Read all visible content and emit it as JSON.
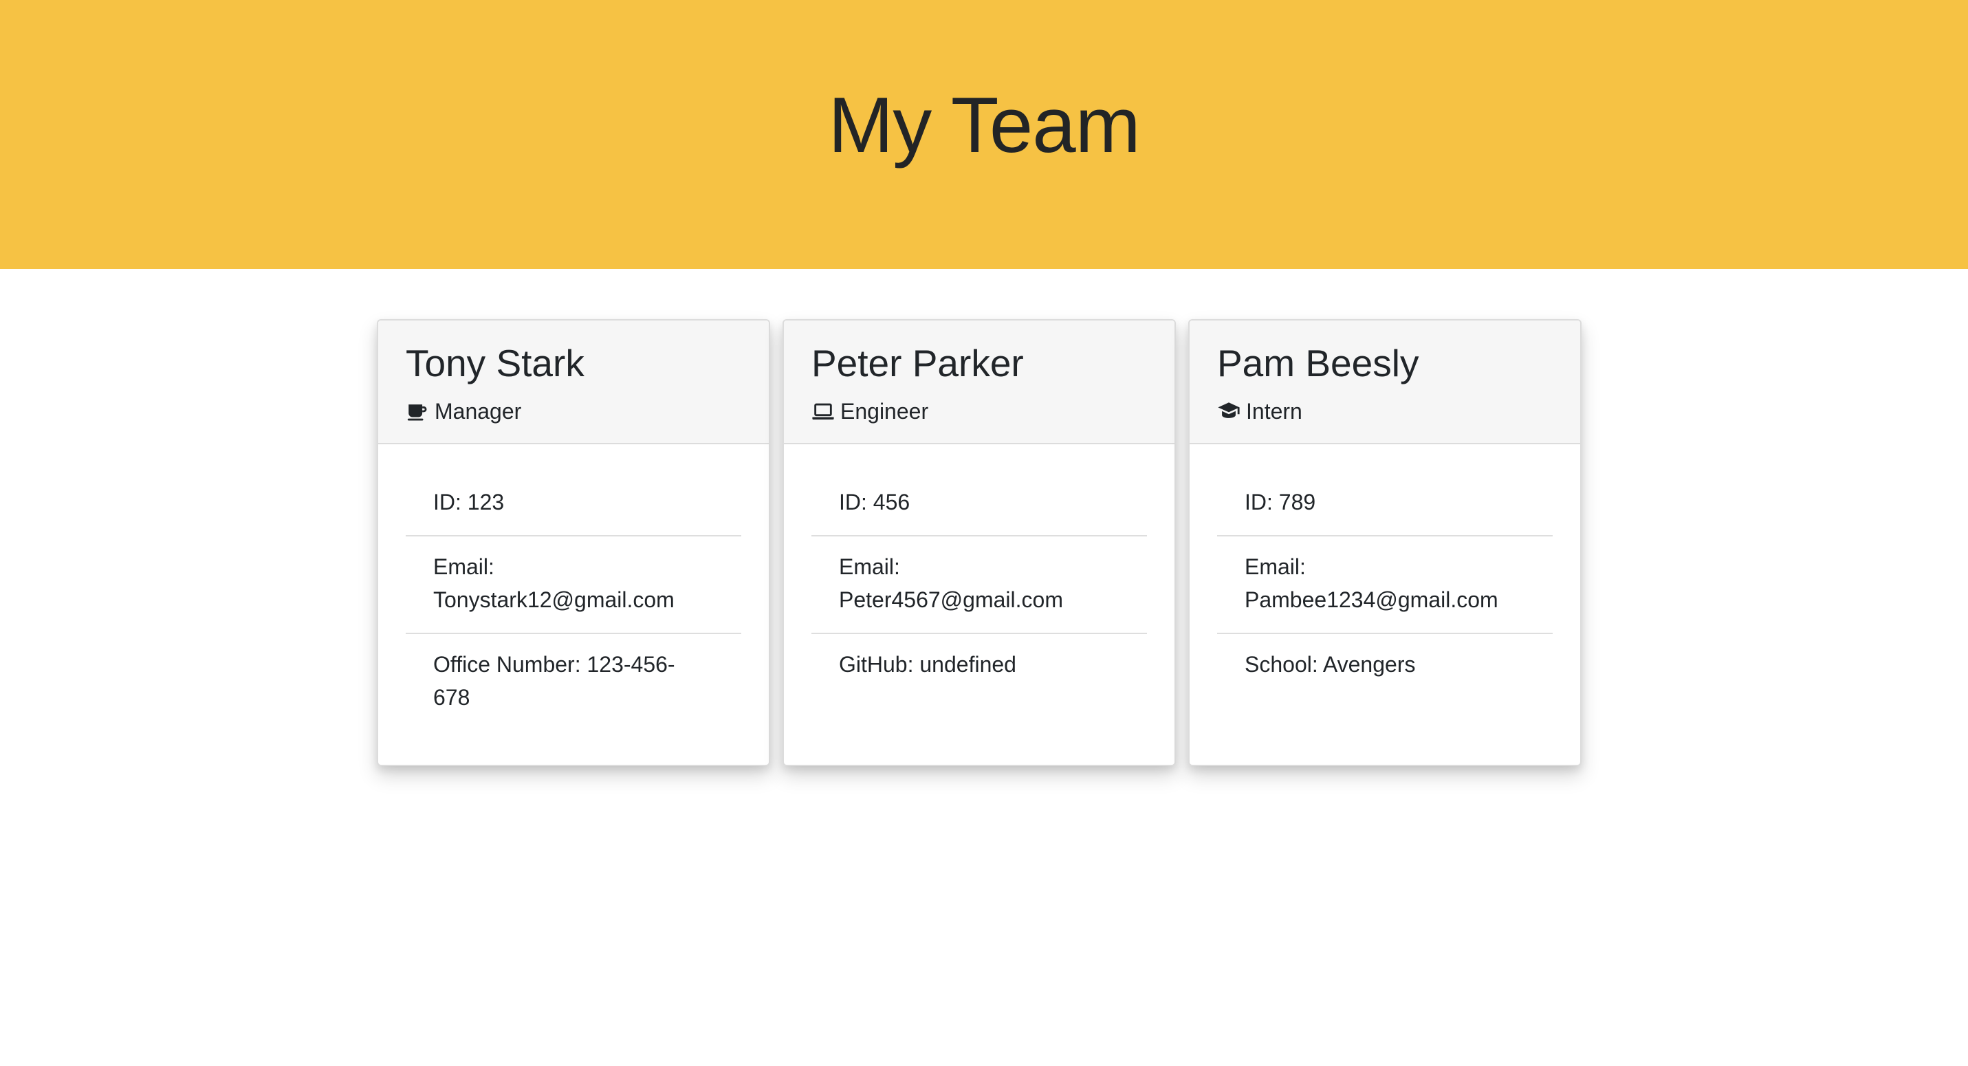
{
  "header": {
    "title": "My Team"
  },
  "team": [
    {
      "name": "Tony Stark",
      "role": "Manager",
      "icon": "coffee-mug-icon",
      "id_text": "ID: 123",
      "email_label": "Email:",
      "email": "Tonystark12@gmail.com",
      "extra_line1": "Office Number: 123-456-",
      "extra_line2": "678"
    },
    {
      "name": "Peter Parker",
      "role": "Engineer",
      "icon": "laptop-icon",
      "id_text": "ID: 456",
      "email_label": "Email:",
      "email": "Peter4567@gmail.com",
      "extra_line1": "GitHub: undefined",
      "extra_line2": ""
    },
    {
      "name": "Pam Beesly",
      "role": "Intern",
      "icon": "graduation-cap-icon",
      "id_text": "ID: 789",
      "email_label": "Email:",
      "email": "Pambee1234@gmail.com",
      "extra_line1": "School: Avengers",
      "extra_line2": ""
    }
  ],
  "colors": {
    "banner": "#f6c244",
    "card_header": "#f6f6f6",
    "text": "#212529"
  }
}
